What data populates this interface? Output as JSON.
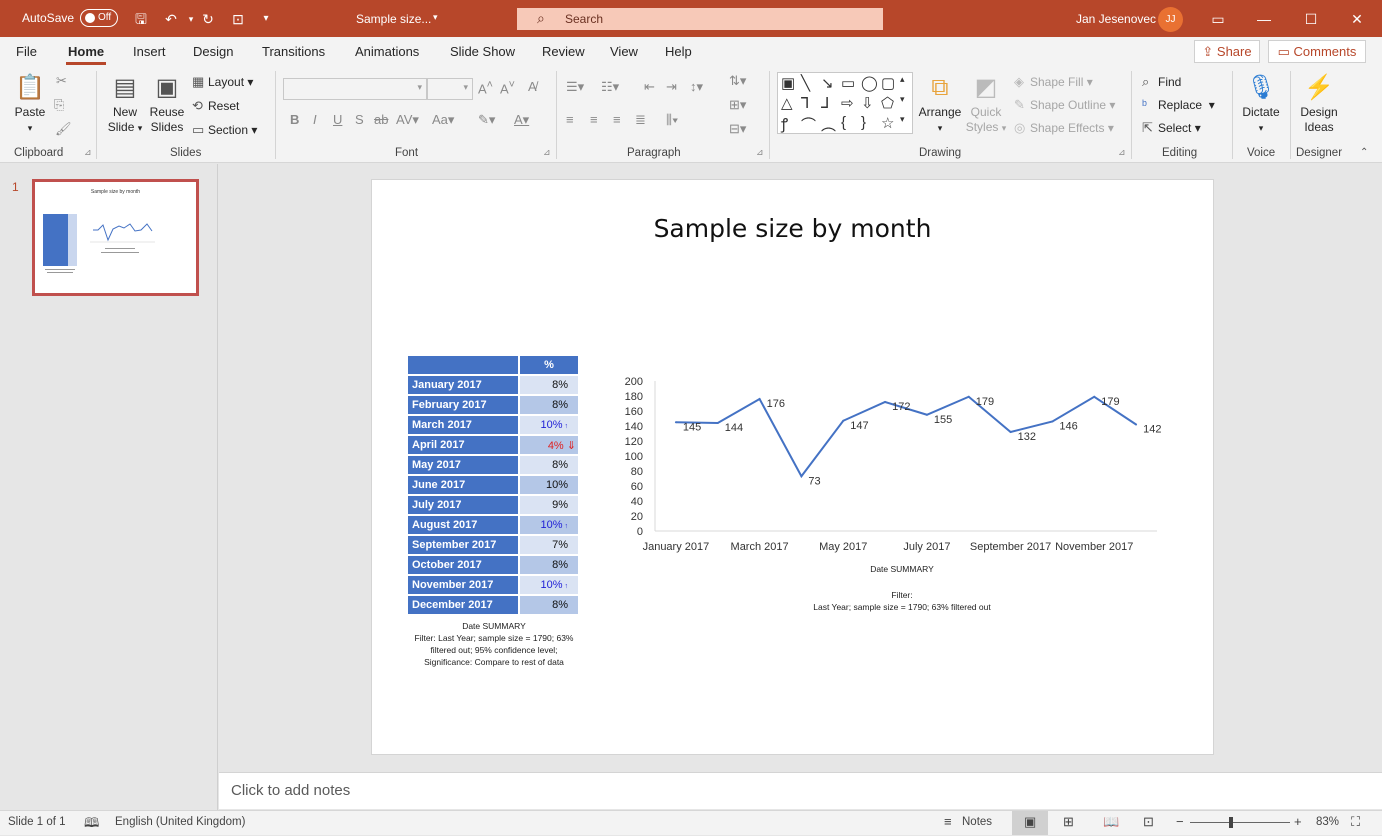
{
  "titlebar": {
    "autosave_label": "AutoSave",
    "autosave_state": "Off",
    "doc_title": "Sample size...",
    "search_placeholder": "Search",
    "user_name": "Jan Jesenovec",
    "user_initials": "JJ"
  },
  "tabs": [
    "File",
    "Home",
    "Insert",
    "Design",
    "Transitions",
    "Animations",
    "Slide Show",
    "Review",
    "View",
    "Help"
  ],
  "active_tab": "Home",
  "share_label": "Share",
  "comments_label": "Comments",
  "ribbon": {
    "clipboard": {
      "paste": "Paste",
      "group": "Clipboard"
    },
    "slides": {
      "new_slide": "New",
      "new_slide2": "Slide",
      "reuse": "Reuse",
      "reuse2": "Slides",
      "layout": "Layout",
      "reset": "Reset",
      "section": "Section",
      "group": "Slides"
    },
    "font": {
      "group": "Font"
    },
    "paragraph": {
      "group": "Paragraph"
    },
    "drawing": {
      "arrange": "Arrange",
      "quick": "Quick",
      "quick2": "Styles",
      "shape_fill": "Shape Fill",
      "shape_outline": "Shape Outline",
      "shape_effects": "Shape Effects",
      "group": "Drawing"
    },
    "editing": {
      "find": "Find",
      "replace": "Replace",
      "select": "Select",
      "group": "Editing"
    },
    "voice": {
      "dictate": "Dictate",
      "group": "Voice"
    },
    "designer": {
      "design": "Design",
      "ideas": "Ideas",
      "group": "Designer"
    }
  },
  "thumbnail": {
    "number": "1",
    "title": "Sample size by month"
  },
  "slide": {
    "title": "Sample size by month",
    "table": {
      "header": "%",
      "rows": [
        {
          "label": "January 2017",
          "value": "8%",
          "mark": ""
        },
        {
          "label": "February 2017",
          "value": "8%",
          "mark": ""
        },
        {
          "label": "March 2017",
          "value": "10%",
          "mark": "up"
        },
        {
          "label": "April 2017",
          "value": "4%",
          "mark": "down"
        },
        {
          "label": "May 2017",
          "value": "8%",
          "mark": ""
        },
        {
          "label": "June 2017",
          "value": "10%",
          "mark": ""
        },
        {
          "label": "July 2017",
          "value": "9%",
          "mark": ""
        },
        {
          "label": "August 2017",
          "value": "10%",
          "mark": "up"
        },
        {
          "label": "September 2017",
          "value": "7%",
          "mark": ""
        },
        {
          "label": "October 2017",
          "value": "8%",
          "mark": ""
        },
        {
          "label": "November 2017",
          "value": "10%",
          "mark": "up"
        },
        {
          "label": "December 2017",
          "value": "8%",
          "mark": ""
        }
      ],
      "foot1": "Date SUMMARY",
      "foot2": "Filter: Last Year; sample size = 1790; 63% filtered out; 95% confidence level; Significance: Compare to rest of data"
    },
    "chart_foot": "Date SUMMARY",
    "chart_filter1": "Filter:",
    "chart_filter2": "Last Year; sample size = 1790; 63% filtered out"
  },
  "chart_data": {
    "type": "line",
    "categories": [
      "January 2017",
      "February 2017",
      "March 2017",
      "April 2017",
      "May 2017",
      "June 2017",
      "July 2017",
      "August 2017",
      "September 2017",
      "October 2017",
      "November 2017",
      "December 2017"
    ],
    "tick_labels": [
      "January 2017",
      "March 2017",
      "May 2017",
      "July 2017",
      "September 2017",
      "November 2017"
    ],
    "values": [
      145,
      144,
      176,
      73,
      147,
      172,
      155,
      179,
      132,
      146,
      179,
      142
    ],
    "ylim": [
      0,
      200
    ],
    "yticks": [
      0,
      20,
      40,
      60,
      80,
      100,
      120,
      140,
      160,
      180,
      200
    ],
    "xlabel": "Date SUMMARY",
    "color": "#4472c4"
  },
  "notes_placeholder": "Click to add notes",
  "status": {
    "slide": "Slide 1 of 1",
    "language": "English (United Kingdom)",
    "notes": "Notes",
    "zoom": "83%"
  }
}
